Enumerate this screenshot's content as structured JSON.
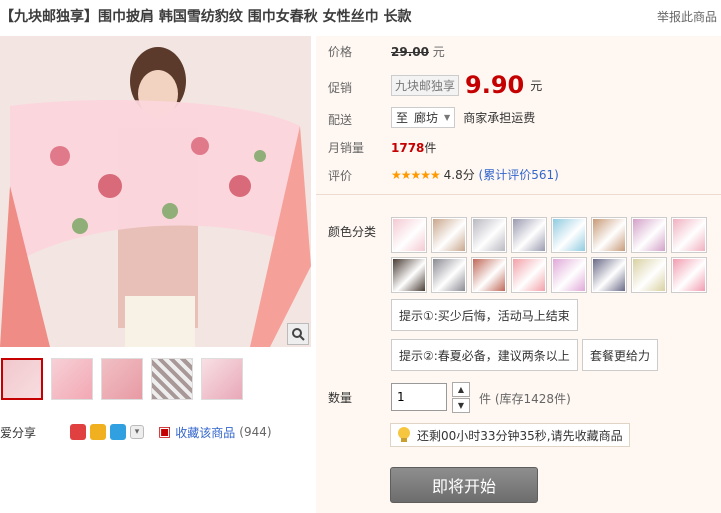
{
  "title": "【九块邮独享】围巾披肩 韩国雪纺豹纹 围巾女春秋 女性丝巾 长款",
  "report_link": "举报此商品",
  "price": {
    "label": "价格",
    "value": "29.00",
    "unit": "元"
  },
  "promo": {
    "label": "促销",
    "tag": "九块邮独享",
    "price": "9.90",
    "unit": "元"
  },
  "delivery": {
    "label": "配送",
    "prefix": "至",
    "city": "廊坊",
    "note": "商家承担运费"
  },
  "monthly_sales": {
    "label": "月销量",
    "count": "1778",
    "unit": "件"
  },
  "rating": {
    "label": "评价",
    "stars": "★★★★★",
    "score": "4.8分",
    "reviews": "(累计评价561)"
  },
  "colors": {
    "label": "颜色分类",
    "swatch_colors": [
      "#f4c9d2",
      "#c9a68c",
      "#b8b8c0",
      "#9a9ab0",
      "#8fcbe0",
      "#c89a78",
      "#d3a0c8",
      "#f0b0c0",
      "#4a3c34",
      "#8a8a92",
      "#c06858",
      "#f2a0a8",
      "#e0a8d8",
      "#6a6a88",
      "#d8d0a0",
      "#f29cb0"
    ]
  },
  "tips": {
    "tip1": "提示①:买少后悔，活动马上结束",
    "tip2": "提示②:春夏必备，建议两条以上",
    "tip3": "套餐更给力"
  },
  "quantity": {
    "label": "数量",
    "value": "1",
    "unit": "件",
    "stock": "(库存1428件)"
  },
  "countdown": "还剩00小时33分钟35秒,请先收藏商品",
  "buy_button": "即将开始",
  "share": {
    "label": "爱分享",
    "fav_label": "收藏该商品",
    "fav_count": "(944)"
  }
}
